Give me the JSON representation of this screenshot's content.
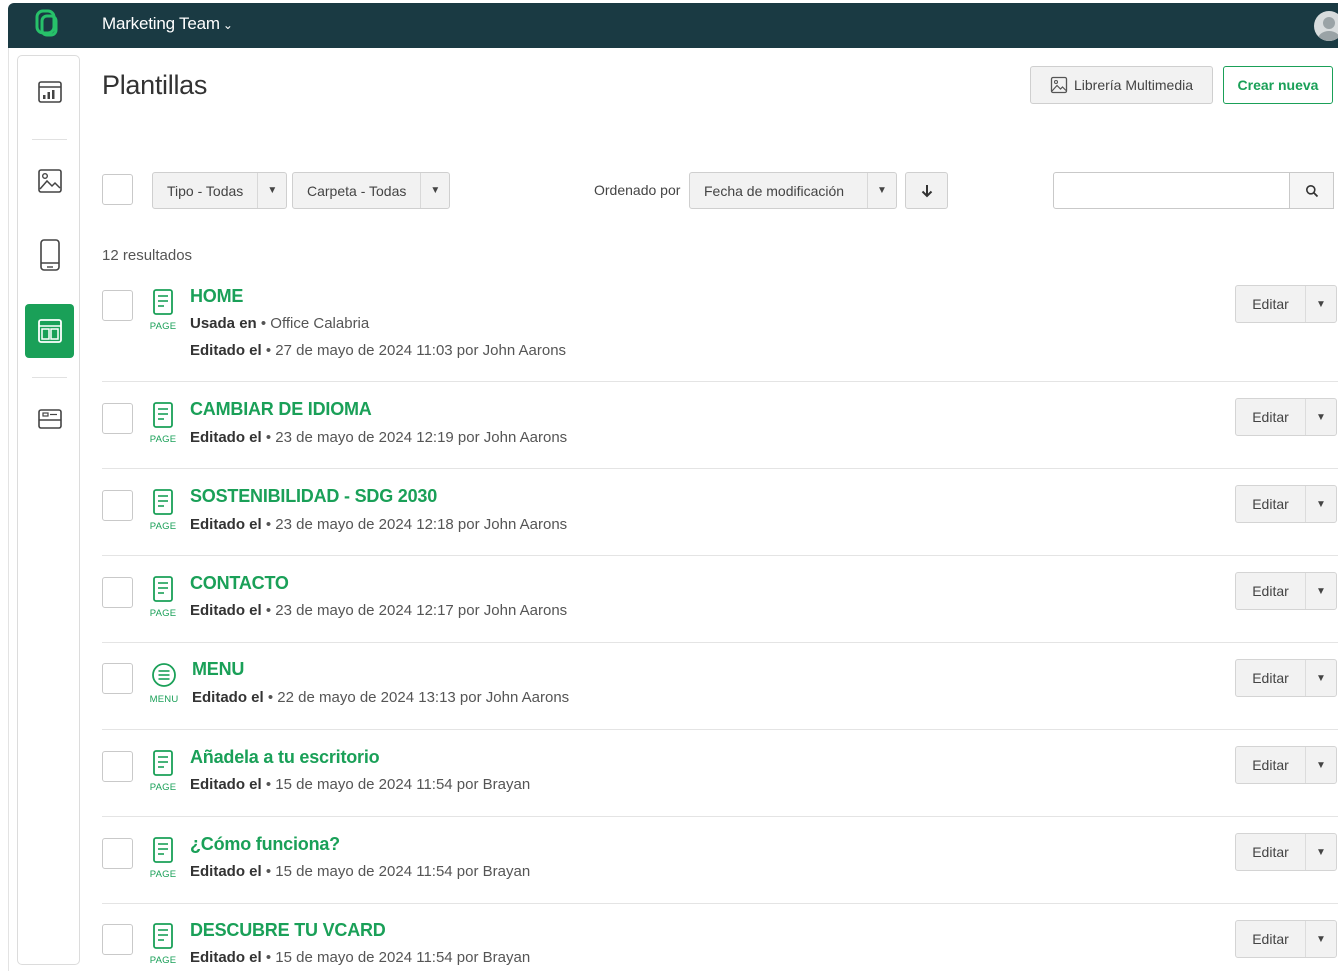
{
  "topbar": {
    "team_name": "Marketing Team",
    "team_chevron": "⌄"
  },
  "page": {
    "title": "Plantillas",
    "media_button": "Librería Multimedia",
    "new_button": "Crear nueva"
  },
  "filters": {
    "type": "Tipo - Todas",
    "folder": "Carpeta - Todas",
    "sort_label": "Ordenado por",
    "sort_value": "Fecha de modificación",
    "search_value": ""
  },
  "results_text": "12 resultados",
  "edit_label": "Editar",
  "sidebar": {
    "items": [
      "analytics-icon",
      "image-icon",
      "mobile-icon",
      "template-icon",
      "card-icon"
    ]
  },
  "colors": {
    "accent": "#1aa058",
    "topbar": "#1a3a43"
  },
  "templates": [
    {
      "type": "PAGE",
      "name": "HOME",
      "used_label": "Usada en",
      "used_value": "Office Calabria",
      "edited_label": "Editado el",
      "edited_value": "27 de mayo de 2024 11:03 por John Aarons"
    },
    {
      "type": "PAGE",
      "name": "CAMBIAR DE IDIOMA",
      "edited_label": "Editado el",
      "edited_value": "23 de mayo de 2024 12:19 por John Aarons"
    },
    {
      "type": "PAGE",
      "name": "SOSTENIBILIDAD - SDG 2030",
      "edited_label": "Editado el",
      "edited_value": "23 de mayo de 2024 12:18 por John Aarons"
    },
    {
      "type": "PAGE",
      "name": "CONTACTO",
      "edited_label": "Editado el",
      "edited_value": "23 de mayo de 2024 12:17 por John Aarons"
    },
    {
      "type": "MENU",
      "name": "MENU",
      "edited_label": "Editado el",
      "edited_value": "22 de mayo de 2024 13:13 por John Aarons"
    },
    {
      "type": "PAGE",
      "name": "Añadela a tu escritorio",
      "edited_label": "Editado el",
      "edited_value": "15 de mayo de 2024 11:54 por Brayan"
    },
    {
      "type": "PAGE",
      "name": "¿Cómo funciona?",
      "edited_label": "Editado el",
      "edited_value": "15 de mayo de 2024 11:54 por Brayan"
    },
    {
      "type": "PAGE",
      "name": "DESCUBRE TU VCARD",
      "edited_label": "Editado el",
      "edited_value": "15 de mayo de 2024 11:54 por Brayan"
    }
  ]
}
